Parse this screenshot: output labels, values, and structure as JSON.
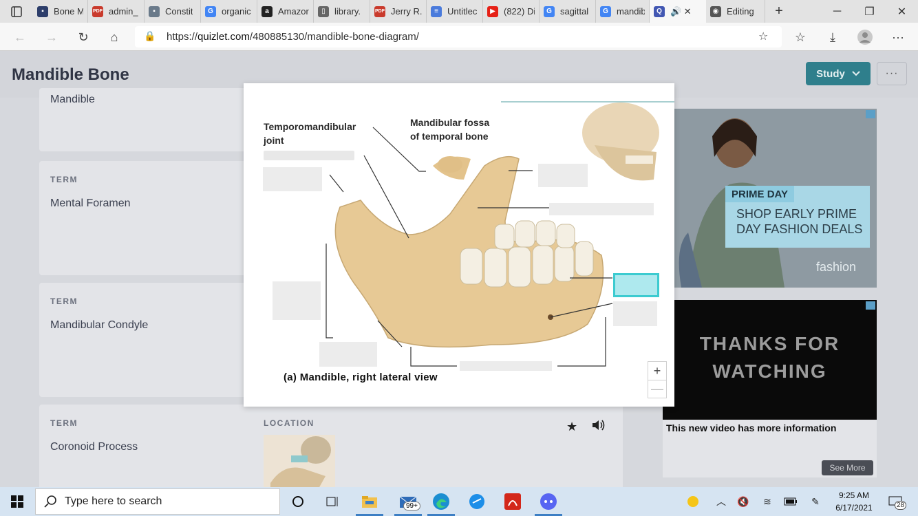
{
  "browser": {
    "tabs": [
      {
        "label": "Bone M",
        "favicon": "bone-icon",
        "color": "#2d3e6b"
      },
      {
        "label": "admin_",
        "favicon": "pdf-icon",
        "color": "#c93a2c"
      },
      {
        "label": "Constit",
        "favicon": "doc-icon",
        "color": "#6a7a8a"
      },
      {
        "label": "organic",
        "favicon": "google-icon",
        "color": "#4285f4"
      },
      {
        "label": "Amazor",
        "favicon": "amazon-icon",
        "color": "#222222"
      },
      {
        "label": "library.",
        "favicon": "file-icon",
        "color": "#666666"
      },
      {
        "label": "Jerry R.",
        "favicon": "pdf-icon",
        "color": "#c93a2c"
      },
      {
        "label": "Untitlec",
        "favicon": "docs-icon",
        "color": "#4a7bdc"
      },
      {
        "label": "(822) Di",
        "favicon": "youtube-icon",
        "color": "#e62117"
      },
      {
        "label": "sagittal",
        "favicon": "google-icon",
        "color": "#4285f4"
      },
      {
        "label": "mandib",
        "favicon": "google-icon",
        "color": "#4285f4"
      },
      {
        "label": "",
        "favicon": "quizlet-icon",
        "color": "#4257b2"
      },
      {
        "label": "Editing",
        "favicon": "app-icon",
        "color": "#555555"
      }
    ],
    "url_prefix": "https://",
    "url_host": "quizlet.com",
    "url_path": "/480885130/mandible-bone-diagram/"
  },
  "page": {
    "title": "Mandible Bone",
    "study_label": "Study",
    "more_label": "···",
    "cards": [
      {
        "term_label": "",
        "term": "Mandible",
        "location_label": ""
      },
      {
        "term_label": "TERM",
        "term": "Mental Foramen",
        "location_label": ""
      },
      {
        "term_label": "TERM",
        "term": "Mandibular Condyle",
        "location_label": ""
      },
      {
        "term_label": "TERM",
        "term": "Coronoid Process",
        "location_label": "LOCATION"
      }
    ]
  },
  "modal": {
    "label_tmj": "Temporomandibular\njoint",
    "label_fossa": "Mandibular fossa\nof temporal bone",
    "caption": "(a) Mandible, right lateral view",
    "zoom_in": "+",
    "zoom_out": "—"
  },
  "ads": {
    "ad1_tag": "PRIME DAY",
    "ad1_text": "SHOP EARLY PRIME DAY FASHION DEALS",
    "ad1_brand": "fashion",
    "ad2_text": "THANKS FOR WATCHING",
    "ad2_caption": "This new video has more information",
    "ad2_button": "See More"
  },
  "taskbar": {
    "search_placeholder": "Type here to search",
    "mail_badge": "99+",
    "time": "9:25 AM",
    "date": "6/17/2021",
    "notifications": "28"
  }
}
